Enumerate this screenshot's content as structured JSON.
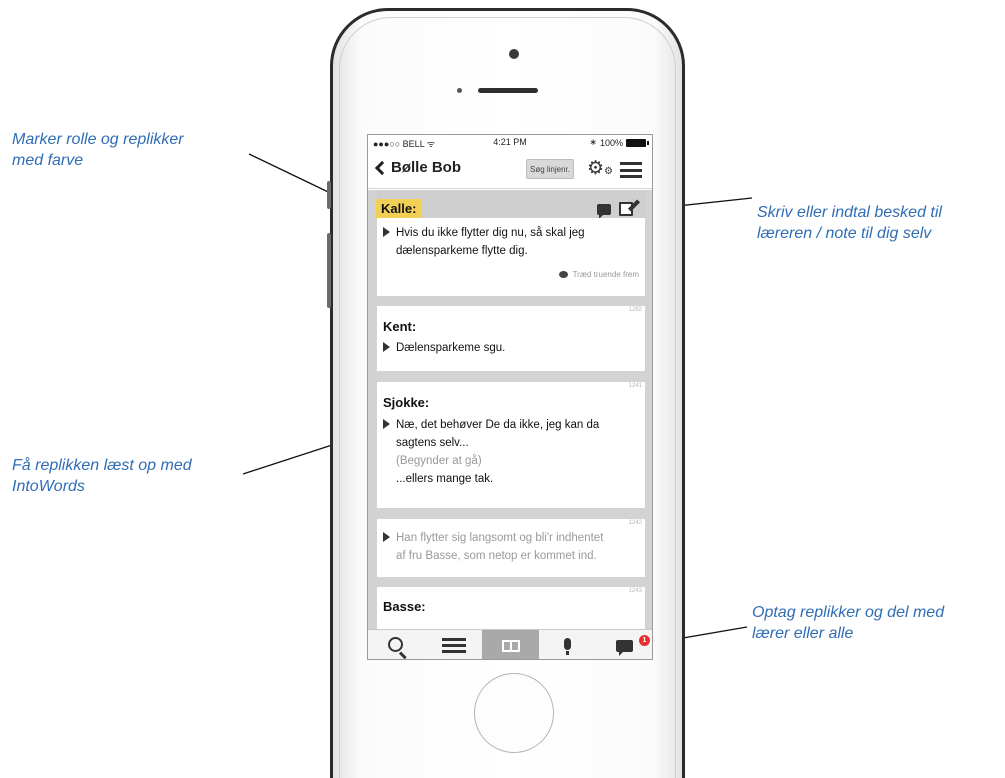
{
  "annotations": {
    "mark_role": [
      "Marker rolle og replikker",
      "med farve"
    ],
    "read_aloud": [
      "Få replikken læst op med",
      "IntoWords"
    ],
    "write_note": [
      "Skriv eller indtal besked til",
      "læreren / note til dig selv"
    ],
    "record": [
      "Optag replikker og del med",
      "lærer eller alle"
    ]
  },
  "status_bar": {
    "carrier": "●●●○○ BELL ᯤ",
    "time": "4:21 PM",
    "bluetooth": "∗",
    "battery": "100%"
  },
  "nav": {
    "back_title": "Bølle Bob",
    "search_button": "Søg linjenr.",
    "gear_icon": "gear-icon",
    "menu_icon": "hamburger-icon"
  },
  "cards": {
    "kalle": {
      "speaker": "Kalle:",
      "line1": "Hvis du ikke flytter dig nu, så skal jeg",
      "line2": "dælensparkeme flytte dig.",
      "tag": "Træd truende frem",
      "highlight_color": "#f2cf55"
    },
    "kent": {
      "num": "1282",
      "speaker": "Kent:",
      "line1": "Dælensparkeme sgu."
    },
    "sjokke": {
      "num": "1241",
      "speaker": "Sjokke:",
      "line1": "Næ, det behøver De da ikke, jeg kan da",
      "line2": "sagtens selv...",
      "direction": "(Begynder at gå)",
      "line3": "...ellers mange tak."
    },
    "stage": {
      "num": "1242",
      "line1": "Han flytter sig langsomt og bli'r indhentet",
      "line2": "af fru Basse, som netop er kommet ind."
    },
    "basse": {
      "num": "1243",
      "speaker": "Basse:"
    }
  },
  "tabbar": {
    "tabs": [
      "search-icon",
      "list-icon",
      "book-icon",
      "mic-icon",
      "message-icon"
    ],
    "active": "book-icon",
    "badge": "1"
  }
}
